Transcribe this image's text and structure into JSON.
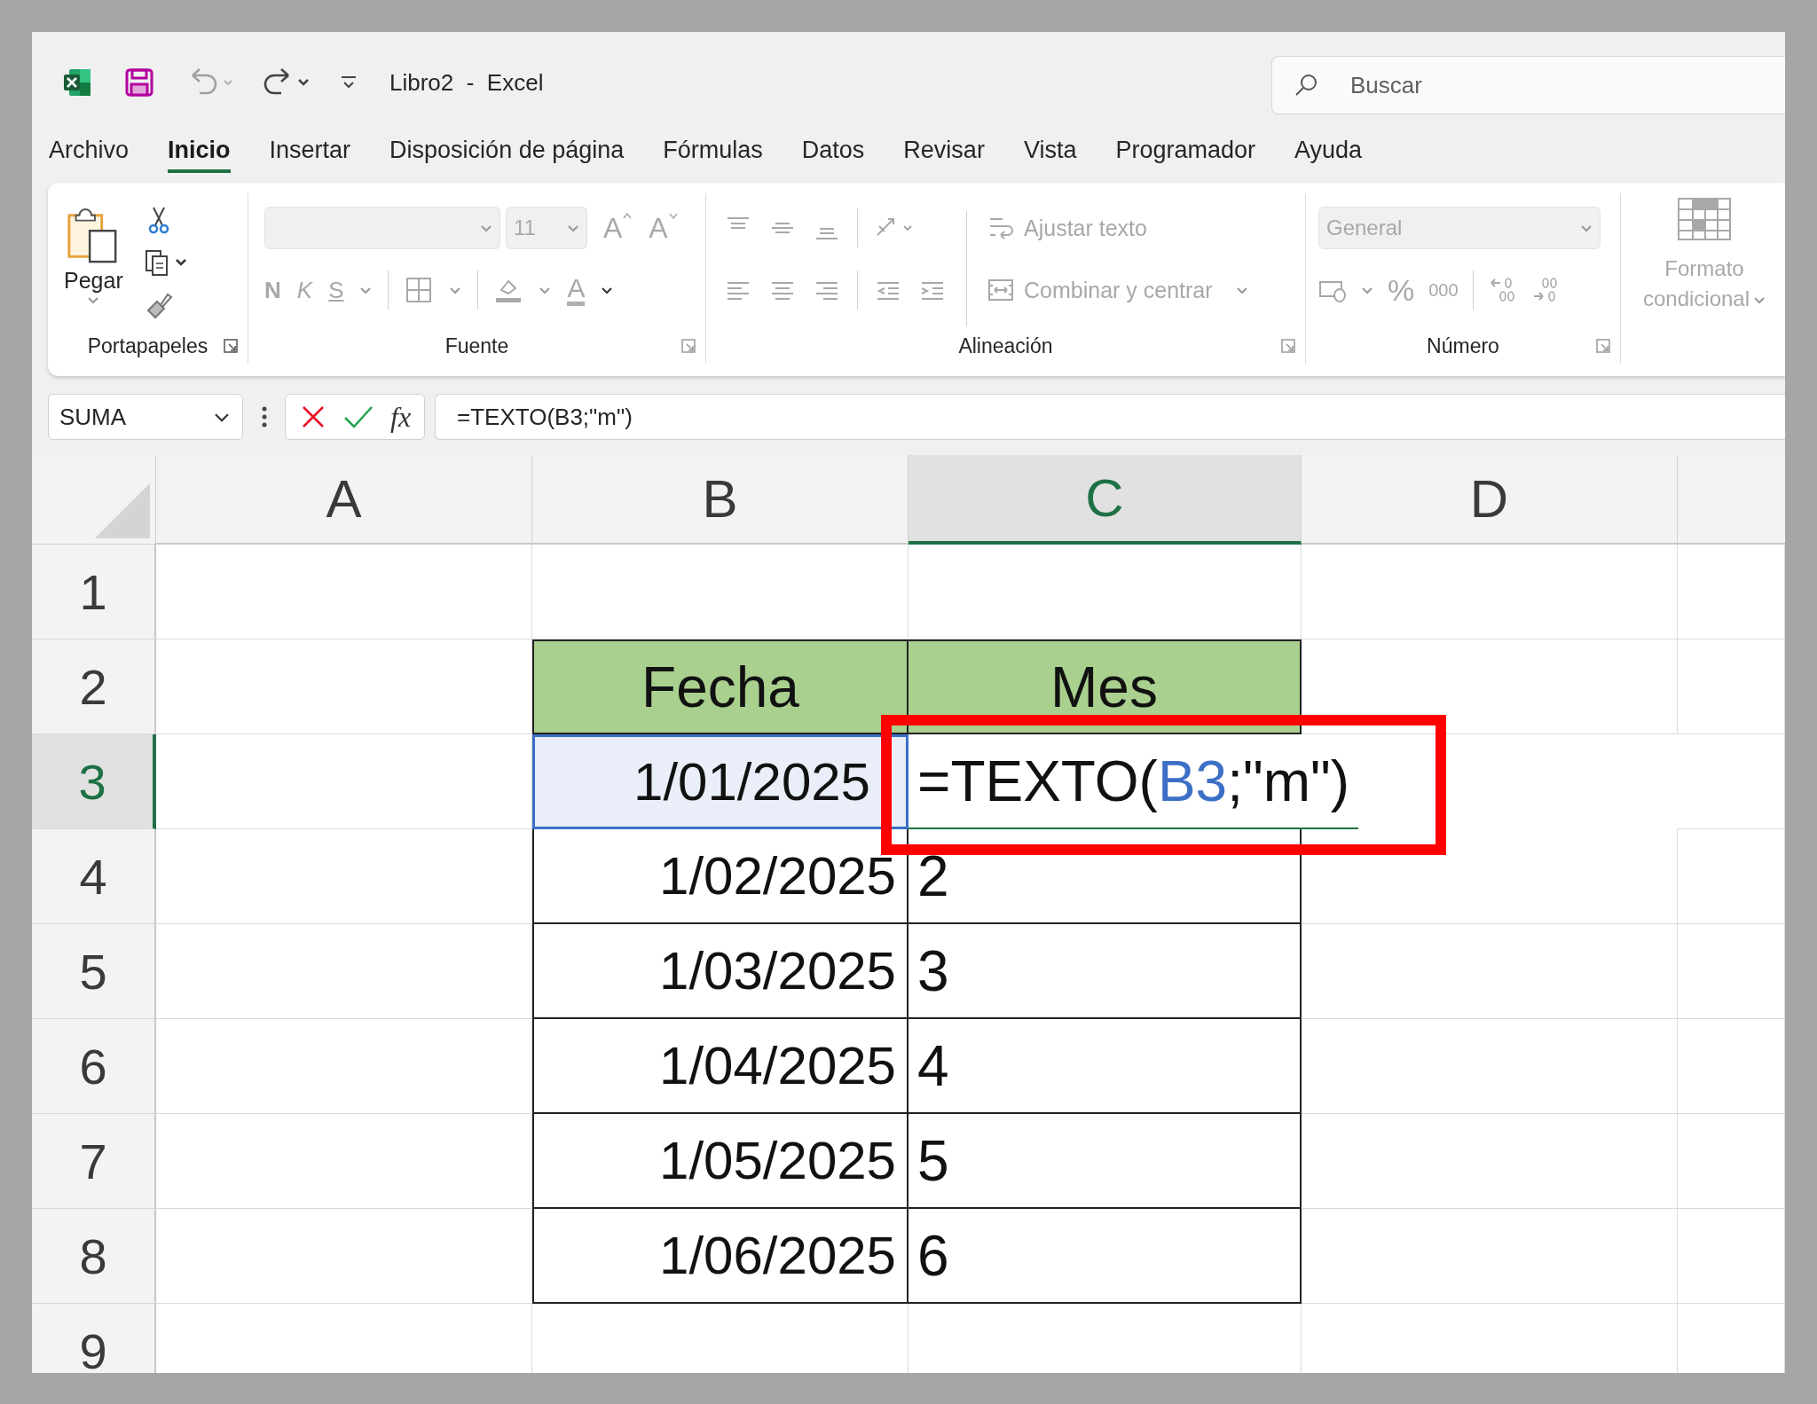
{
  "title_bar": {
    "title": "Libro2  -  Excel",
    "search": {
      "placeholder": "Buscar"
    }
  },
  "tabs": [
    {
      "label": "Archivo",
      "selected": false
    },
    {
      "label": "Inicio",
      "selected": true
    },
    {
      "label": "Insertar",
      "selected": false
    },
    {
      "label": "Disposición de página",
      "selected": false
    },
    {
      "label": "Fórmulas",
      "selected": false
    },
    {
      "label": "Datos",
      "selected": false
    },
    {
      "label": "Revisar",
      "selected": false
    },
    {
      "label": "Vista",
      "selected": false
    },
    {
      "label": "Programador",
      "selected": false
    },
    {
      "label": "Ayuda",
      "selected": false
    }
  ],
  "ribbon": {
    "clipboard": {
      "label": "Portapapeles",
      "paste": "Pegar"
    },
    "font": {
      "label": "Fuente",
      "disabled": true,
      "size": "11",
      "grow": "A",
      "shrink": "A",
      "bold": "N",
      "italic": "K",
      "underline": "S",
      "color_button": "A"
    },
    "alignment": {
      "label": "Alineación",
      "disabled": true,
      "wrap": "Ajustar texto",
      "merge": "Combinar y centrar"
    },
    "number": {
      "label": "Número",
      "disabled": true,
      "format": "General",
      "percent": "%",
      "thousands": "000"
    },
    "styles": {
      "disabled": true,
      "conditional": "Formato condicional"
    }
  },
  "formula_bar": {
    "name_box": "SUMA",
    "fx": "fx",
    "formula": "=TEXTO(B3;\"m\")"
  },
  "sheet": {
    "columns": [
      {
        "label": "A",
        "selected": false
      },
      {
        "label": "B",
        "selected": false
      },
      {
        "label": "C",
        "selected": true
      },
      {
        "label": "D",
        "selected": false
      }
    ],
    "rows": [
      {
        "label": "1",
        "selected": false
      },
      {
        "label": "2",
        "selected": false
      },
      {
        "label": "3",
        "selected": true
      },
      {
        "label": "4",
        "selected": false
      },
      {
        "label": "5",
        "selected": false
      },
      {
        "label": "6",
        "selected": false
      },
      {
        "label": "7",
        "selected": false
      },
      {
        "label": "8",
        "selected": false
      },
      {
        "label": "9",
        "selected": false
      }
    ],
    "table": {
      "header": [
        "Fecha",
        "Mes"
      ],
      "rows": [
        {
          "date": {
            "text": "1/01/2025",
            "referenced": true
          },
          "month": {
            "kind": "formula",
            "highlighted": true,
            "parts": [
              {
                "text": "=TEXTO(",
                "kind": "plain"
              },
              {
                "text": "B3",
                "kind": "reference"
              },
              {
                "text": ";\"m\")",
                "kind": "plain"
              }
            ]
          }
        },
        {
          "date": {
            "text": "1/02/2025",
            "referenced": false
          },
          "month": {
            "kind": "value",
            "text": "2"
          }
        },
        {
          "date": {
            "text": "1/03/2025",
            "referenced": false
          },
          "month": {
            "kind": "value",
            "text": "3"
          }
        },
        {
          "date": {
            "text": "1/04/2025",
            "referenced": false
          },
          "month": {
            "kind": "value",
            "text": "4"
          }
        },
        {
          "date": {
            "text": "1/05/2025",
            "referenced": false
          },
          "month": {
            "kind": "value",
            "text": "5"
          }
        },
        {
          "date": {
            "text": "1/06/2025",
            "referenced": false
          },
          "month": {
            "kind": "value",
            "text": "6"
          }
        }
      ]
    }
  }
}
